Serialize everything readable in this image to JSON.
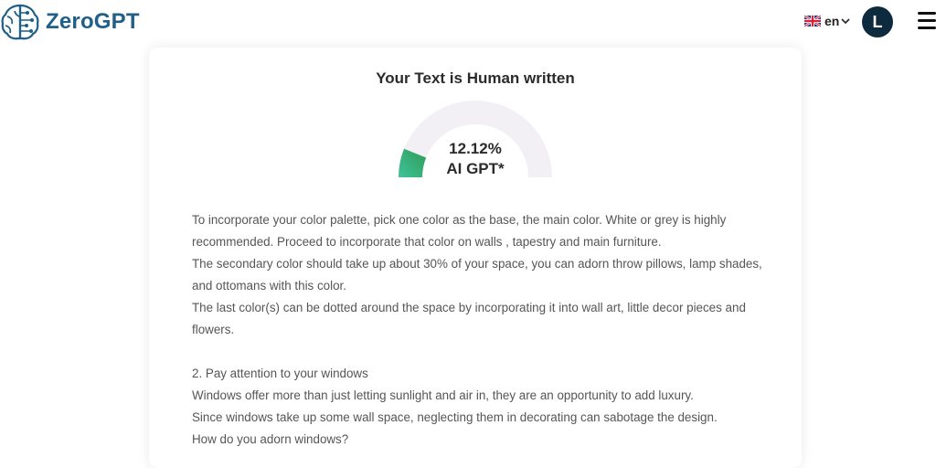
{
  "brand": {
    "name": "ZeroGPT",
    "logo_icon": "brain-icon",
    "accent": "#1f5f88"
  },
  "header": {
    "language_label": "en",
    "flag_icon": "uk-flag-icon",
    "avatar_letter": "L",
    "menu_icon": "hamburger-menu-icon"
  },
  "result": {
    "title": "Your Text is Human written",
    "percentage": "12.12%",
    "label": "AI GPT*",
    "ai_fraction": 0.1212,
    "gauge_colors": {
      "fill_start": "#3fc29b",
      "fill_end": "#2e9c55",
      "track": "#f2f0f5"
    }
  },
  "text_lines": [
    "To incorporate your color palette, pick one color as the base, the main color. White or grey is highly",
    "recommended. Proceed to incorporate that color on walls , tapestry and main furniture.",
    "The secondary color should take up about 30% of your space, you can adorn throw pillows, lamp shades,",
    "and ottomans with this color.",
    "The last color(s) can be dotted around the space by incorporating it into wall art, little decor pieces and",
    "flowers.",
    "",
    "2. Pay attention to your windows",
    "Windows offer more than just letting sunlight and air in, they are an opportunity to add luxury.",
    "Since windows take up some wall space, neglecting them in decorating can sabotage the design.",
    "How do you adorn windows?"
  ]
}
